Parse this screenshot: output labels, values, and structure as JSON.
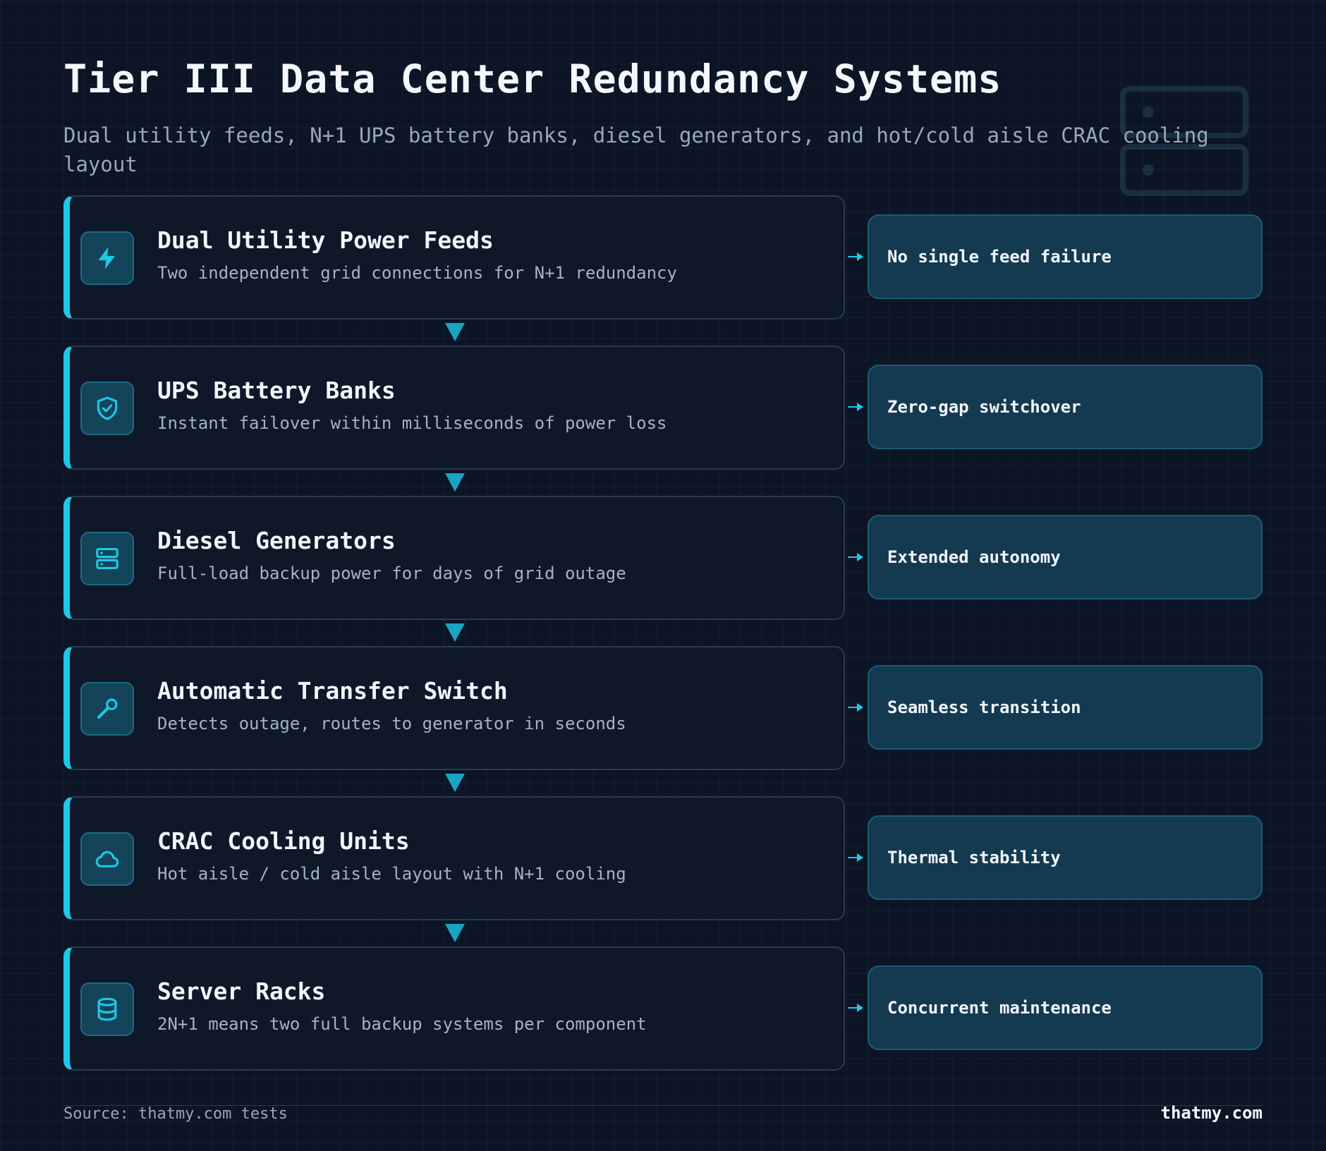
{
  "header": {
    "title": "Tier III Data Center Redundancy Systems",
    "subtitle": "Dual utility feeds, N+1 UPS battery banks, diesel generators, and hot/cold aisle CRAC cooling layout"
  },
  "colors": {
    "background": "#0c1526",
    "accent": "#1ec8e6",
    "card": "#0e1829",
    "outcome_card": "#143a52"
  },
  "steps": [
    {
      "icon": "lightning-icon",
      "title": "Dual Utility Power Feeds",
      "description": "Two independent grid connections for N+1 redundancy",
      "outcome": "No single feed failure"
    },
    {
      "icon": "shield-check-icon",
      "title": "UPS Battery Banks",
      "description": "Instant failover within milliseconds of power loss",
      "outcome": "Zero-gap switchover"
    },
    {
      "icon": "server-icon",
      "title": "Diesel Generators",
      "description": "Full-load backup power for days of grid outage",
      "outcome": "Extended autonomy"
    },
    {
      "icon": "wrench-icon",
      "title": "Automatic Transfer Switch",
      "description": "Detects outage, routes to generator in seconds",
      "outcome": "Seamless transition"
    },
    {
      "icon": "cloud-icon",
      "title": "CRAC Cooling Units",
      "description": "Hot aisle / cold aisle layout with N+1 cooling",
      "outcome": "Thermal stability"
    },
    {
      "icon": "database-icon",
      "title": "Server Racks",
      "description": "2N+1 means two full backup systems per component",
      "outcome": "Concurrent maintenance"
    }
  ],
  "footer": {
    "source": "Source: thatmy.com tests",
    "brand": "thatmy.com"
  }
}
